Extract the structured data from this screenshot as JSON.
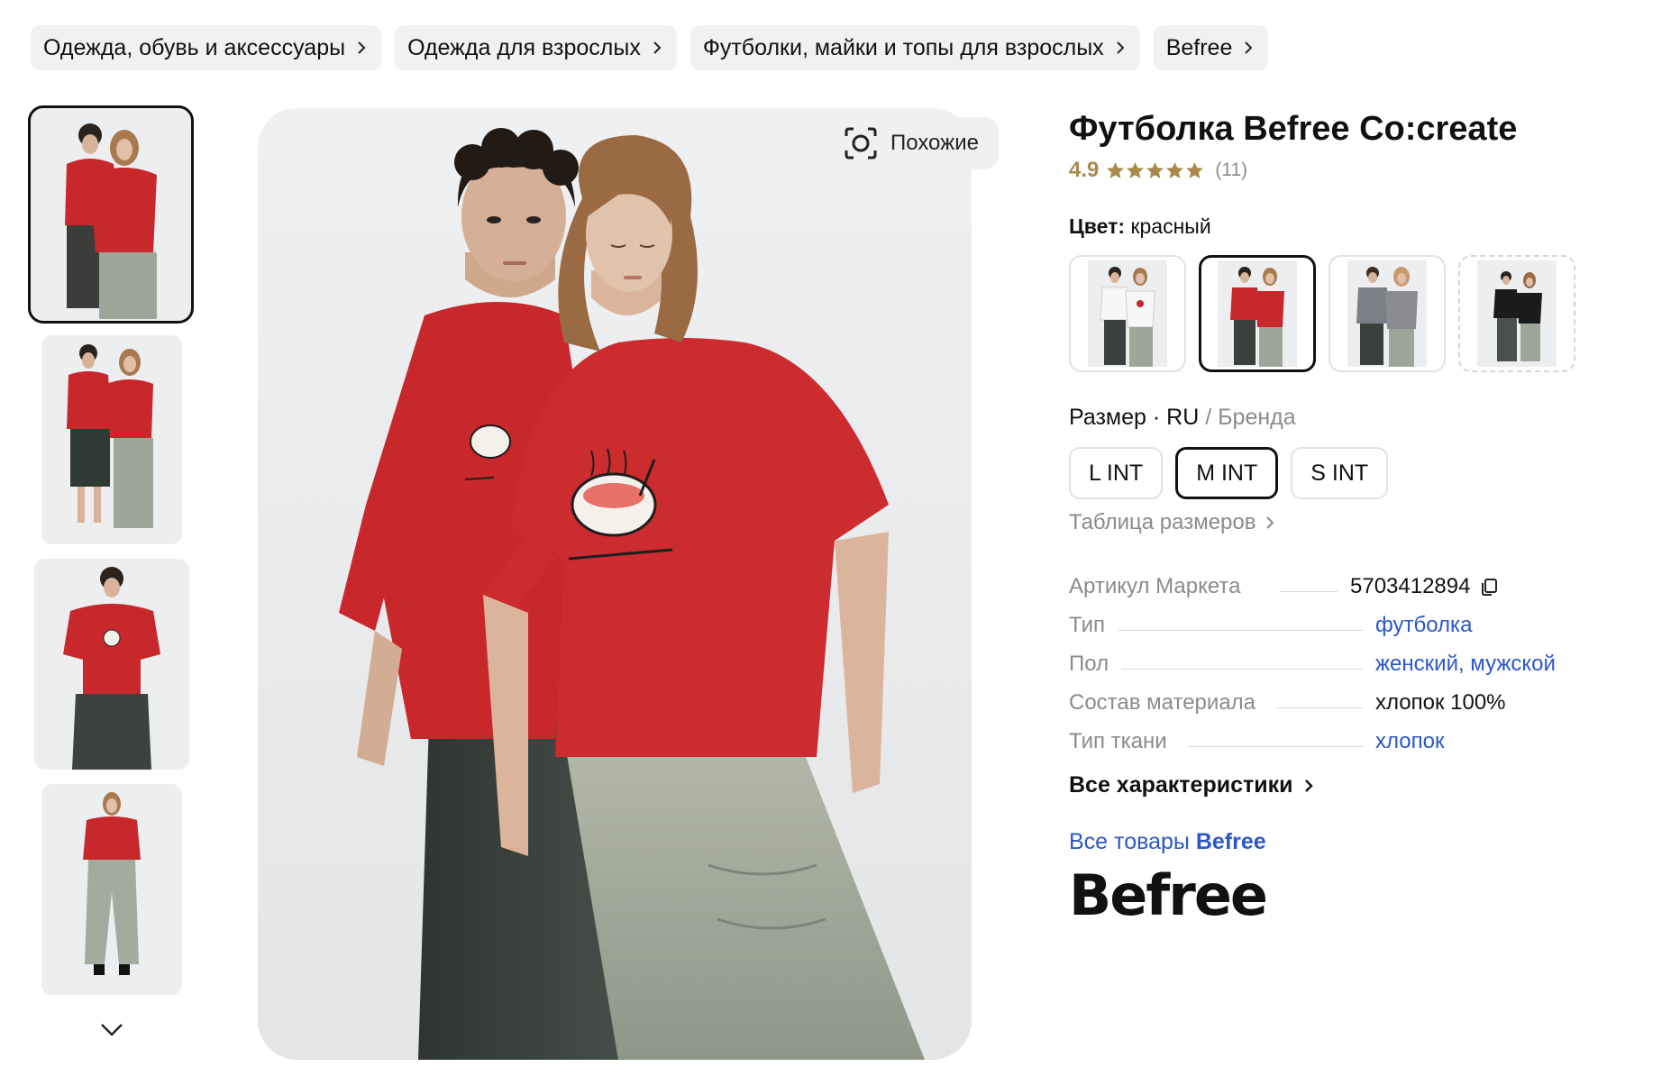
{
  "breadcrumbs": [
    {
      "label": "Одежда, обувь и аксессуары"
    },
    {
      "label": "Одежда для взрослых"
    },
    {
      "label": "Футболки, майки и топы для взрослых"
    },
    {
      "label": "Befree"
    }
  ],
  "gallery": {
    "similar_label": "Похожие",
    "selected_index": 0,
    "thumbnail_count": 4
  },
  "product": {
    "title": "Футболка Befree Co:create",
    "rating": "4.9",
    "stars": 5,
    "reviews": "(11)"
  },
  "color": {
    "label": "Цвет:",
    "value": "красный",
    "options": [
      "white",
      "red",
      "grey",
      "black"
    ],
    "selected_index": 1
  },
  "size": {
    "label": "Размер",
    "system_ru": "RU",
    "system_brand": "Бренда",
    "options": [
      "L INT",
      "M INT",
      "S INT"
    ],
    "selected_index": 1,
    "table_link": "Таблица размеров"
  },
  "specs": [
    {
      "label": "Артикул Маркета",
      "value": "5703412894",
      "link": false,
      "copy": true
    },
    {
      "label": "Тип",
      "value": "футболка",
      "link": true
    },
    {
      "label": "Пол",
      "value": "женский, мужской",
      "link": true
    },
    {
      "label": "Состав материала",
      "value": "хлопок 100%",
      "link": false
    },
    {
      "label": "Тип ткани",
      "value": "хлопок",
      "link": true
    }
  ],
  "all_characteristics": "Все характеристики",
  "all_goods": {
    "prefix": "Все товары",
    "brand": "Befree"
  },
  "brand_logo": "Befree",
  "colors": {
    "rating_gold": "#a88a4e",
    "link_blue": "#2b57c7",
    "shirt_red": "#c8282c",
    "muted_text": "#8b8b8b"
  }
}
